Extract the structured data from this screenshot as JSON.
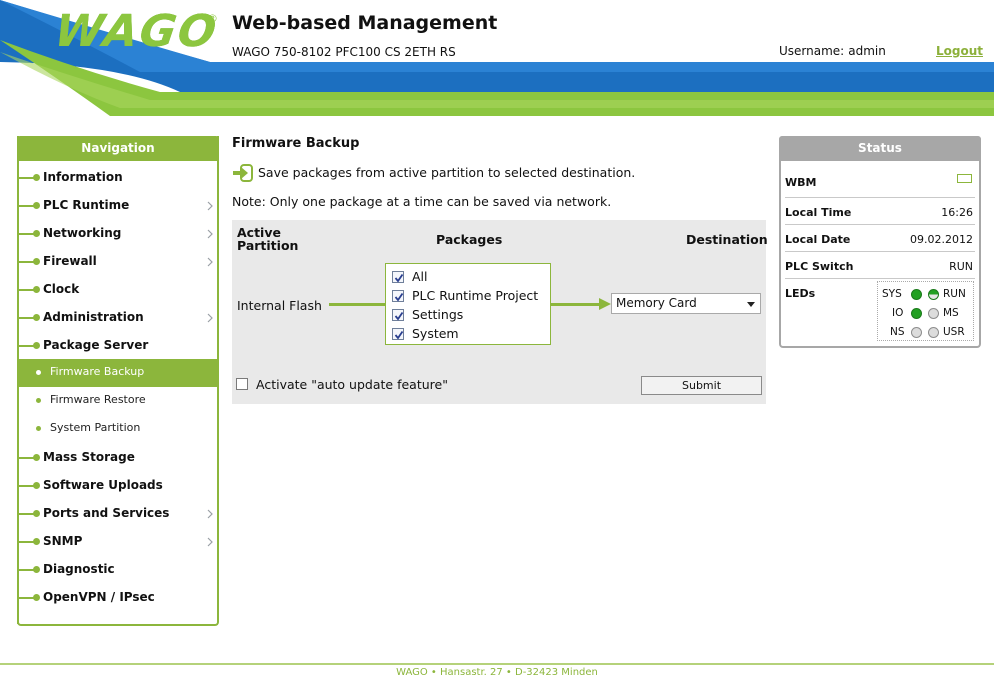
{
  "header": {
    "logo_text": "WAGO",
    "logo_reg": "®",
    "title": "Web-based Management",
    "device": "WAGO 750-8102 PFC100 CS 2ETH RS",
    "username_label": "Username:",
    "username": "admin",
    "logout": "Logout"
  },
  "nav": {
    "title": "Navigation",
    "items": [
      {
        "label": "Information",
        "chevron": false
      },
      {
        "label": "PLC Runtime",
        "chevron": true
      },
      {
        "label": "Networking",
        "chevron": true
      },
      {
        "label": "Firewall",
        "chevron": true
      },
      {
        "label": "Clock",
        "chevron": false
      },
      {
        "label": "Administration",
        "chevron": true
      },
      {
        "label": "Package Server",
        "chevron": false
      }
    ],
    "subitems": [
      {
        "label": "Firmware Backup",
        "active": true
      },
      {
        "label": "Firmware Restore",
        "active": false
      },
      {
        "label": "System Partition",
        "active": false
      }
    ],
    "items2": [
      {
        "label": "Mass Storage",
        "chevron": false
      },
      {
        "label": "Software Uploads",
        "chevron": false
      },
      {
        "label": "Ports and Services",
        "chevron": true
      },
      {
        "label": "SNMP",
        "chevron": true
      },
      {
        "label": "Diagnostic",
        "chevron": false
      },
      {
        "label": "OpenVPN / IPsec",
        "chevron": false
      }
    ]
  },
  "main": {
    "title": "Firmware Backup",
    "description": "Save packages from active partition to selected destination.",
    "note": "Note: Only one package at a time can be saved via network.",
    "col_active_1": "Active",
    "col_active_2": "Partition",
    "col_packages": "Packages",
    "col_destination": "Destination",
    "source": "Internal Flash",
    "packages": [
      {
        "label": "All",
        "checked": true
      },
      {
        "label": "PLC Runtime Project",
        "checked": true
      },
      {
        "label": "Settings",
        "checked": true
      },
      {
        "label": "System",
        "checked": true
      }
    ],
    "destination": "Memory Card",
    "auto_update": "Activate \"auto update feature\"",
    "submit": "Submit"
  },
  "status": {
    "title": "Status",
    "wbm_label": "WBM",
    "local_time_label": "Local Time",
    "local_time": "16:26",
    "local_date_label": "Local Date",
    "local_date": "09.02.2012",
    "plc_switch_label": "PLC Switch",
    "plc_switch": "RUN",
    "leds_label": "LEDs",
    "leds": {
      "sys": "SYS",
      "run": "RUN",
      "io": "IO",
      "ms": "MS",
      "ns": "NS",
      "usr": "USR"
    }
  },
  "footer": "WAGO • Hansastr. 27 • D-32423 Minden",
  "colors": {
    "accent": "#8cb63c",
    "band_blue": "#1c6fc0",
    "status_grey": "#a7a7a7"
  }
}
